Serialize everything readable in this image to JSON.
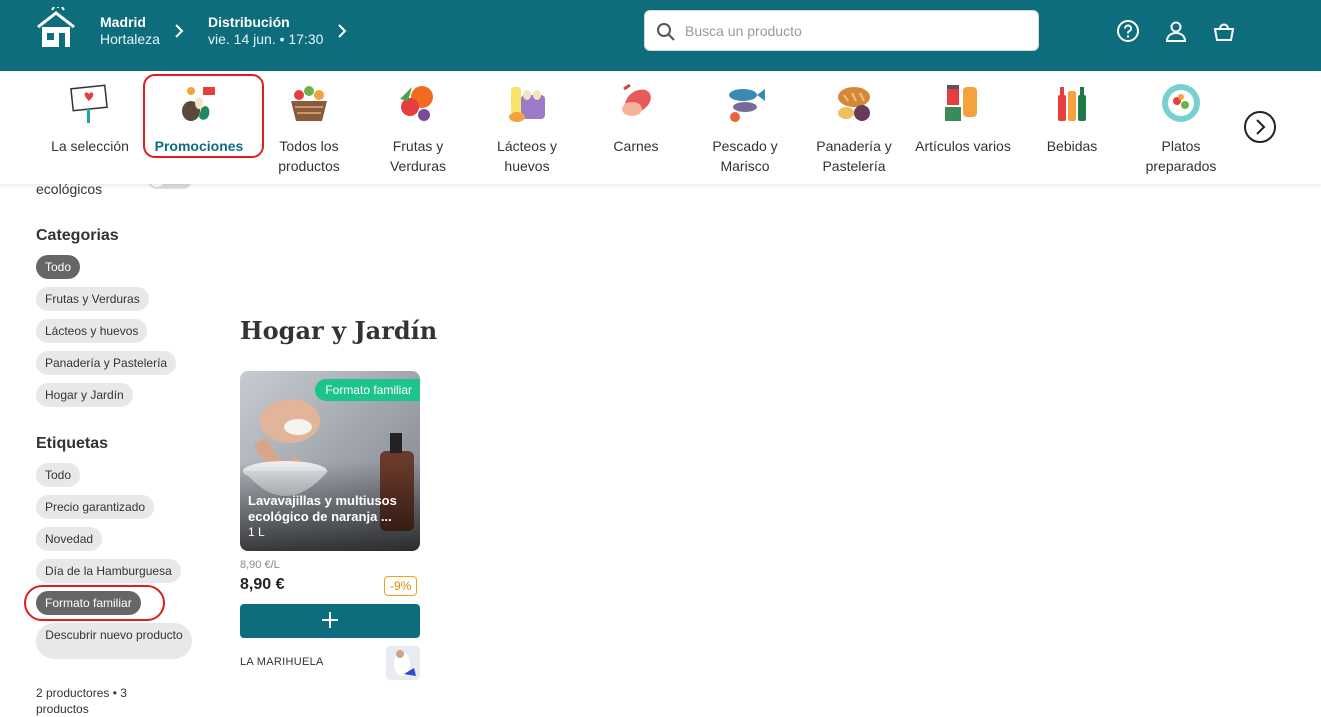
{
  "header": {
    "location_city": "Madrid",
    "location_area": "Hortaleza",
    "delivery_title": "Distribución",
    "delivery_time": "vie. 14 jun. • 17:30",
    "search_placeholder": "Busca un producto",
    "brand_color": "#0e6d7c"
  },
  "categories": [
    {
      "label": "La selección",
      "icon": "selection-sign-icon"
    },
    {
      "label": "Promociones",
      "icon": "promotions-icon",
      "active": true
    },
    {
      "label": "Todos los productos",
      "icon": "all-products-basket-icon"
    },
    {
      "label": "Frutas y Verduras",
      "icon": "fruits-vegetables-icon"
    },
    {
      "label": "Lácteos y huevos",
      "icon": "dairy-eggs-icon"
    },
    {
      "label": "Carnes",
      "icon": "meat-icon"
    },
    {
      "label": "Pescado y Marisco",
      "icon": "fish-seafood-icon"
    },
    {
      "label": "Panadería y Pastelería",
      "icon": "bakery-icon"
    },
    {
      "label": "Artículos varios",
      "icon": "misc-items-icon"
    },
    {
      "label": "Bebidas",
      "icon": "drinks-icon"
    },
    {
      "label": "Platos preparados",
      "icon": "prepared-dishes-icon"
    }
  ],
  "sidebar": {
    "eco_label": "ecológicos",
    "categories_title": "Categorias",
    "categories": [
      "Todo",
      "Frutas y Verduras",
      "Lácteos y huevos",
      "Panadería y Pastelería",
      "Hogar y Jardín"
    ],
    "tags_title": "Etiquetas",
    "tags": [
      "Todo",
      "Precio garantizado",
      "Novedad",
      "Día de la Hamburguesa",
      "Formato familiar"
    ],
    "discover_label": "Descubrir nuevo producto",
    "producer_count": "2 productores • 3 productos"
  },
  "main": {
    "section_title": "Hogar y Jardín",
    "product": {
      "badge": "Formato familiar",
      "name_line1": "Lavavajillas y multiusos",
      "name_line2": "ecológico de naranja ...",
      "quantity": "1 L",
      "unit_price": "8,90 €/L",
      "price": "8,90 €",
      "discount": "-9%",
      "producer": "LA MARIHUELA"
    }
  }
}
